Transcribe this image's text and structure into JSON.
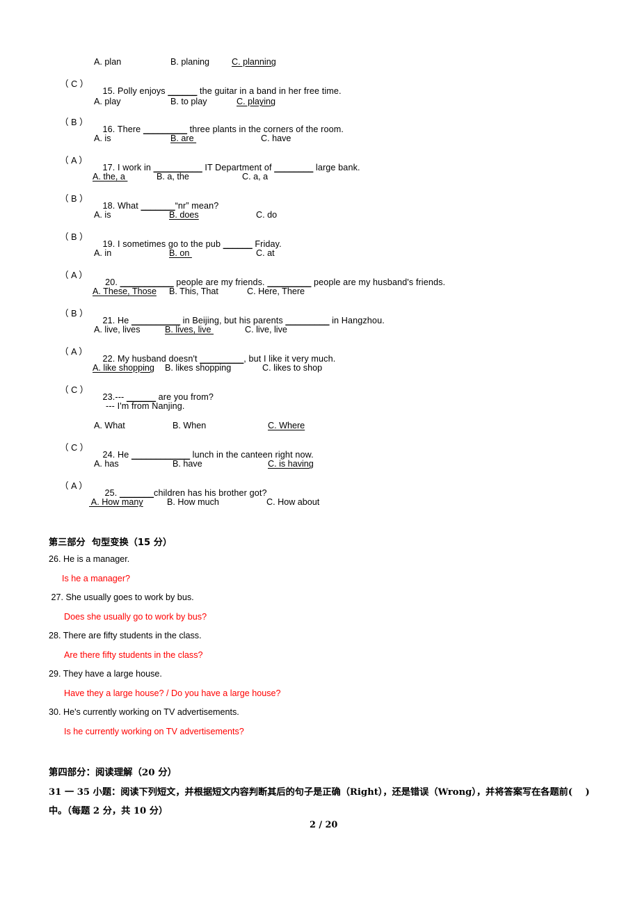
{
  "document": {
    "page_footer": "2 / 20",
    "answer_color": "#FF0000",
    "text_color": "#000000"
  },
  "multiple_choice": {
    "q14_options": {
      "a": "A. plan",
      "b": "B. planing",
      "c": "C. planning"
    },
    "questions": [
      {
        "marker": "（ C ）",
        "stem": "15. Polly enjoys ______ the guitar in a band in her free time.",
        "stem_pre": "15. Polly enjoys ",
        "stem_blank": "______",
        "stem_post": " the guitar in a band in her free time.",
        "options": [
          "A. play",
          "B. to play",
          "C. playing"
        ],
        "answer": "C"
      },
      {
        "marker": "（ B ）",
        "stem_pre": "16. There ",
        "stem_blank": "_________",
        "stem_post": " three plants in the corners of the room.",
        "options": [
          "A. is",
          "B. are ",
          "C. have"
        ],
        "answer": "B"
      },
      {
        "marker": "（ A ）",
        "stem_pre": "17. I work in ",
        "stem_blank": "__________",
        "stem_mid": " IT Department of ",
        "stem_blank2": "________",
        "stem_post": " large bank.",
        "options": [
          "A. the, a ",
          "B. a, the",
          "C. a, a"
        ],
        "answer": "A"
      },
      {
        "marker": "（ B ）",
        "stem_pre": "18. What ",
        "stem_blank": "_______",
        "stem_post": "“nr” mean?",
        "options": [
          "A. is",
          "B. does",
          "C. do"
        ],
        "answer": "B"
      },
      {
        "marker": "（ B ）",
        "stem_pre": "19. I sometimes go to the pub ",
        "stem_blank": "______",
        "stem_post": " Friday.",
        "options": [
          "A. in",
          "B. on ",
          "C. at"
        ],
        "answer": "B"
      },
      {
        "marker": "（ A ）",
        "stem_pre": " 20. ",
        "stem_blank": "___________",
        "stem_mid": " people are my friends. ",
        "stem_blank2": "_________",
        "stem_post": " people are my husband's friends.",
        "options": [
          "A. These, Those",
          "B. This, That",
          "C. Here, There"
        ],
        "answer": "A"
      },
      {
        "marker": "（ B ）",
        "stem_pre": "21. He ",
        "stem_blank": "__________",
        "stem_mid": " in Beijing, but his parents ",
        "stem_blank2": "_________",
        "stem_post": " in Hangzhou.",
        "options": [
          "A. live, lives",
          "B. lives, live ",
          "C. live, live"
        ],
        "answer": "B"
      },
      {
        "marker": "（ A ）",
        "stem_pre": "22. My husband doesn't ",
        "stem_blank": "_________",
        "stem_post": ", but I like it very much.",
        "options": [
          "A. like shopping",
          "B. likes shopping",
          "C. likes to shop"
        ],
        "answer": "A"
      },
      {
        "marker": "（ C ）",
        "stem_pre": "23.--- ",
        "stem_blank": "______",
        "stem_post": " are you from?",
        "stem_line2": "--- I'm from Nanjing.",
        "options": [
          "A. What",
          "B. When",
          "C. Where"
        ],
        "answer": "C"
      },
      {
        "marker": "（ C ）",
        "stem_pre": "24. He ",
        "stem_blank": "____________",
        "stem_post": " lunch in the canteen right now.",
        "options": [
          "A. has",
          "B. have",
          "C. is having"
        ],
        "answer": "C"
      },
      {
        "marker": "（ A ）",
        "stem_pre": "25. ",
        "stem_blank": "_______",
        "stem_post": "children has his brother got?",
        "options": [
          " A. How many",
          "B. How much",
          "C. How about"
        ],
        "answer": "A"
      }
    ]
  },
  "part_three": {
    "heading": "第三部分  句型变换（15 分）",
    "items": [
      {
        "question": "26. He is a manager.",
        "answer": "Is he a manager?"
      },
      {
        "question": " 27. She usually goes to work by bus.",
        "answer": "Does she usually go to work by bus?"
      },
      {
        "question": "28. There are fifty students in the class.",
        "answer": "Are there fifty students in the class?"
      },
      {
        "question": "29. They have a large house.",
        "answer": "Have they a large house? / Do you have a large house?"
      },
      {
        "question": "30. He's currently working on TV advertisements.",
        "answer": "Is he currently working on TV advertisements?"
      }
    ]
  },
  "part_four": {
    "heading": "第四部分：阅读理解（20 分）",
    "instruction_line1": "31 一 35 小题：阅读下列短文，并根据短文内容判断其后的句子是正确（Right），还是错误（Wrong），并将答案写在各题前(    )",
    "instruction_line2": "中。（每题 2 分，共 10 分）"
  }
}
